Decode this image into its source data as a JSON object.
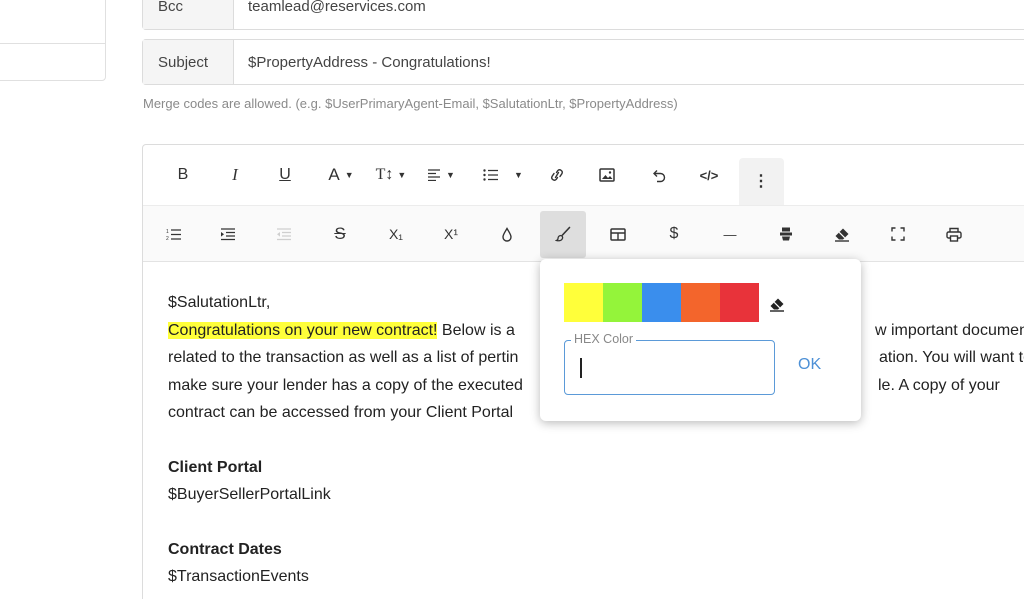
{
  "form": {
    "bcc_label": "Bcc",
    "bcc_value": "teamlead@reservices.com",
    "subject_label": "Subject",
    "subject_value": "$PropertyAddress - Congratulations!",
    "help_text": "Merge codes are allowed. (e.g. $UserPrimaryAgent-Email, $SalutationLtr, $PropertyAddress)"
  },
  "toolbar1": [
    {
      "name": "bold-button",
      "label": "B"
    },
    {
      "name": "italic-button",
      "label": "I"
    },
    {
      "name": "underline-button",
      "label": "U"
    },
    {
      "name": "font-color-dropdown",
      "label": "A"
    },
    {
      "name": "font-size-dropdown",
      "label": "T↕"
    },
    {
      "name": "align-dropdown",
      "icon": "align-left-icon"
    },
    {
      "name": "bullet-list-dropdown",
      "icon": "bullet-list-icon"
    },
    {
      "name": "link-button",
      "icon": "link-icon"
    },
    {
      "name": "image-button",
      "icon": "image-icon"
    },
    {
      "name": "undo-button",
      "icon": "undo-icon"
    },
    {
      "name": "code-view-button",
      "label": "</>"
    },
    {
      "name": "more-button",
      "label": "⋮"
    }
  ],
  "toolbar2": [
    {
      "name": "ordered-list-button",
      "icon": "ordered-list-icon"
    },
    {
      "name": "indent-button",
      "icon": "indent-icon"
    },
    {
      "name": "outdent-button",
      "icon": "outdent-icon",
      "disabled": true
    },
    {
      "name": "strikethrough-button",
      "label": "S"
    },
    {
      "name": "subscript-button",
      "label": "X₁"
    },
    {
      "name": "superscript-button",
      "label": "X¹"
    },
    {
      "name": "text-color-button",
      "icon": "drop-icon"
    },
    {
      "name": "background-color-button",
      "icon": "brush-icon",
      "active": true
    },
    {
      "name": "table-button",
      "icon": "table-icon"
    },
    {
      "name": "merge-code-button",
      "label": "$"
    },
    {
      "name": "horizontal-line-button",
      "label": "—"
    },
    {
      "name": "clear-format-button",
      "icon": "format-clear-icon"
    },
    {
      "name": "eraser-button",
      "icon": "eraser-icon"
    },
    {
      "name": "fullscreen-button",
      "icon": "fullscreen-icon"
    },
    {
      "name": "print-button",
      "icon": "print-icon"
    }
  ],
  "content": {
    "salutation": "$SalutationLtr,",
    "highlighted": "Congratulations on your new contract!",
    "line1_rest": " Below is a",
    "line1_tail": "w important documen",
    "line2_start": "related to the transaction as well as a list of pertin",
    "line2_tail": "ation. You will want to",
    "line3_start": "make sure your lender has a copy of the executed",
    "line3_tail": "le. A copy of your",
    "line4_start": "contract can be accessed from your Client Portal",
    "client_portal_heading": "Client Portal",
    "client_portal_code": "$BuyerSellerPortalLink",
    "contract_dates_heading": "Contract Dates",
    "contract_dates_code": "$TransactionEvents"
  },
  "color_popup": {
    "swatches": [
      "#ffff3a",
      "#94f43a",
      "#3a8eed",
      "#f3652c",
      "#e8333a"
    ],
    "hex_label": "HEX Color",
    "hex_value": "",
    "ok_label": "OK"
  }
}
